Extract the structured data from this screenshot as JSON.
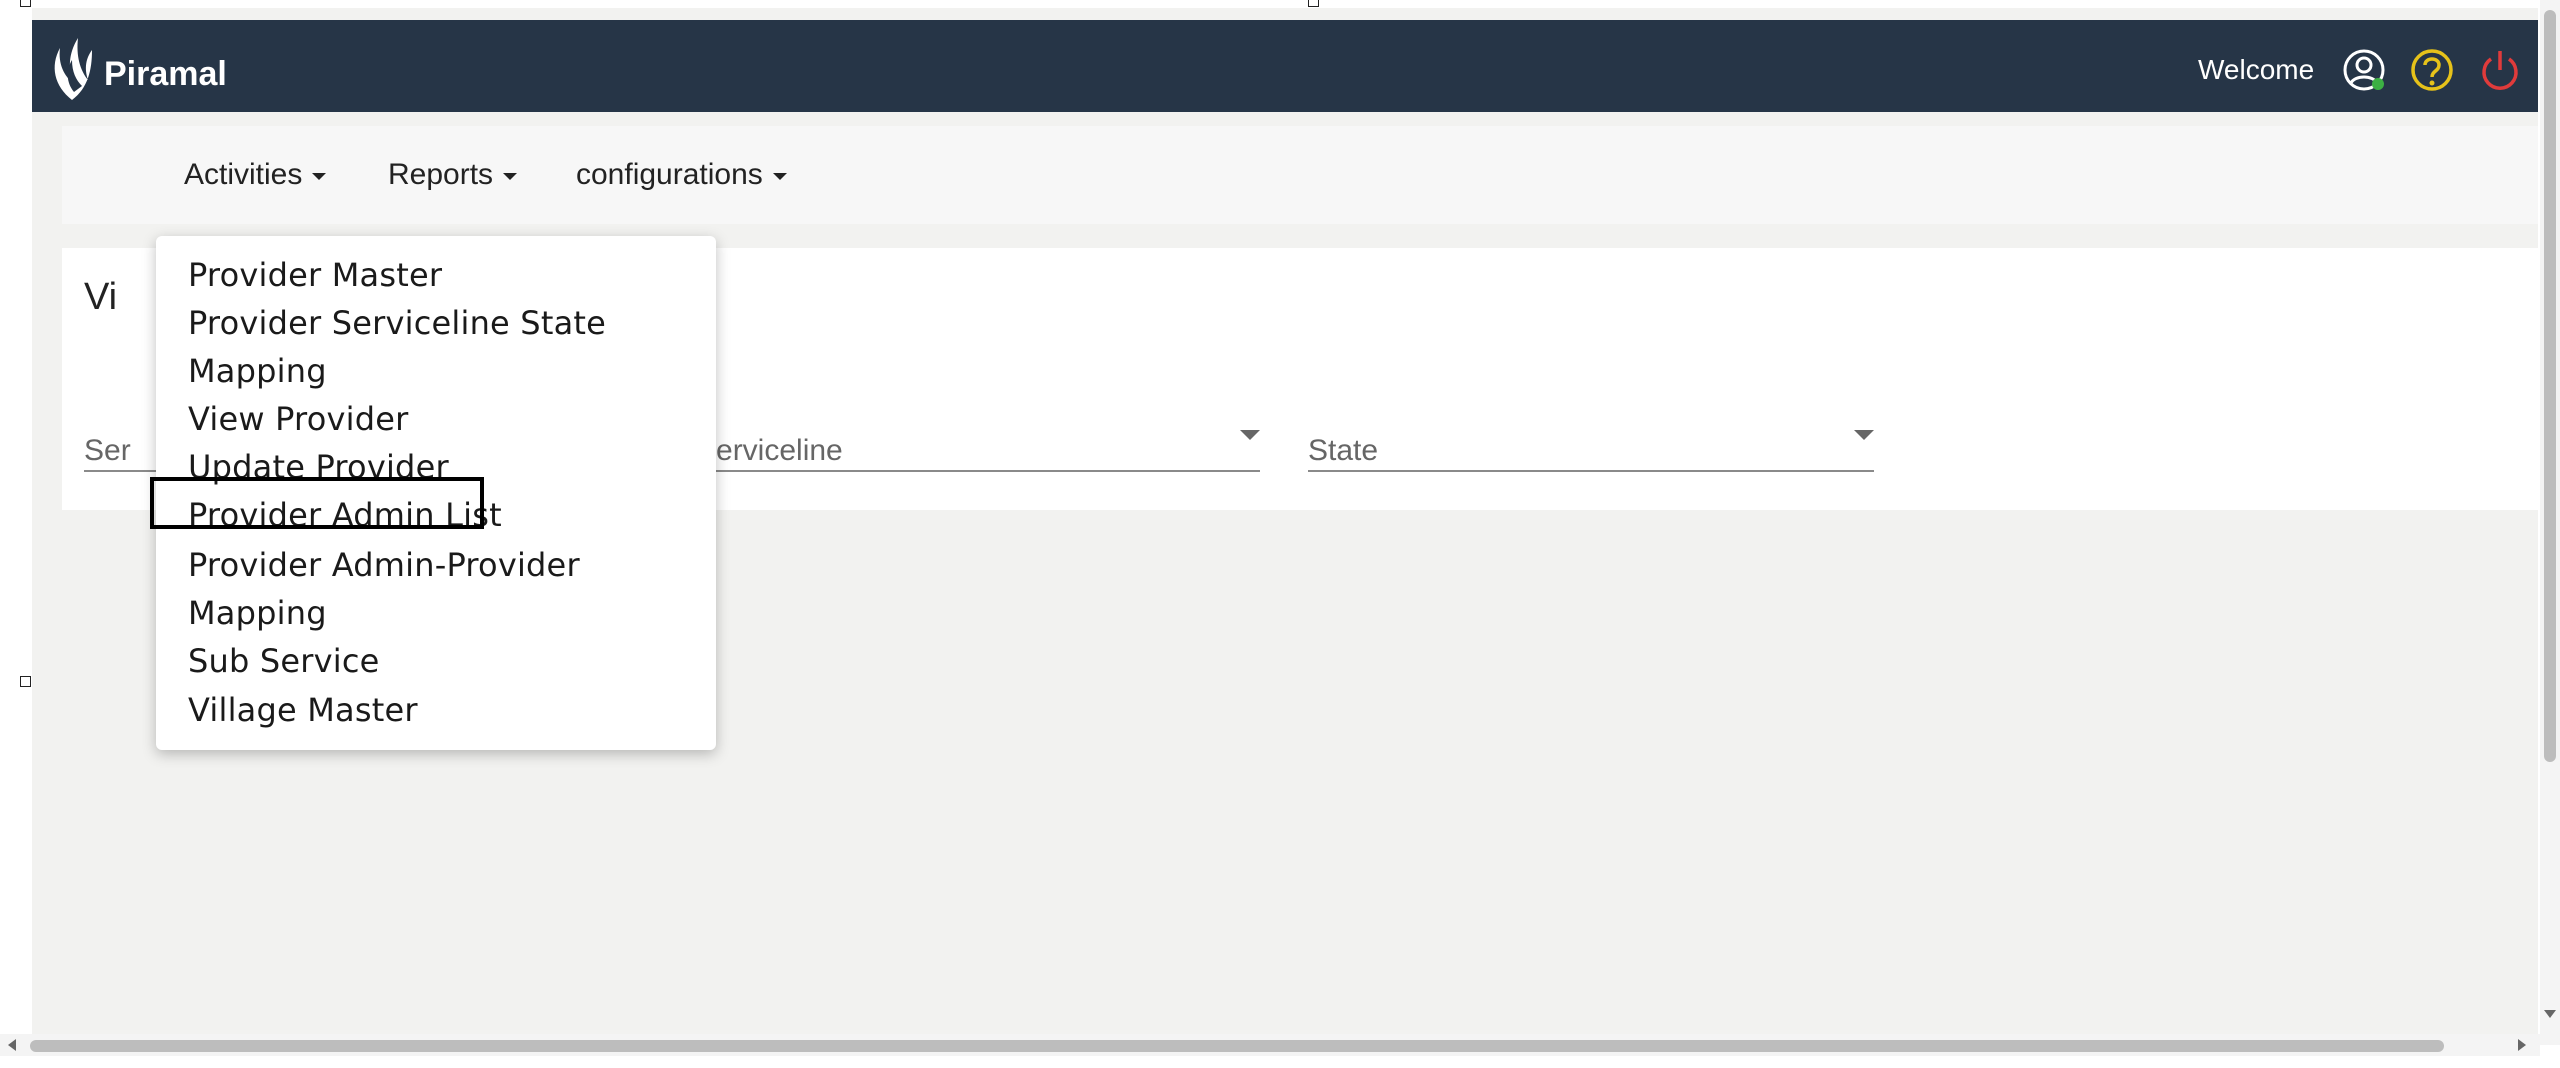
{
  "header": {
    "logo_text": "Piramal",
    "welcome": "Welcome",
    "brand_color": "#263547",
    "help_color": "#e6c21a",
    "power_color": "#e03b3b"
  },
  "nav": {
    "items": [
      {
        "label": "Activities"
      },
      {
        "label": "Reports"
      },
      {
        "label": "configurations"
      }
    ]
  },
  "card": {
    "title": "Vi",
    "field1_label": "Ser",
    "field2_label": "Serviceline",
    "field3_label": "State"
  },
  "dropdown": {
    "items": [
      "Provider Master",
      "Provider Serviceline State",
      "Mapping",
      "View Provider",
      "Update Provider",
      "Provider Admin List",
      "Provider Admin-Provider",
      "Mapping",
      "Sub Service",
      "Village Master"
    ]
  }
}
